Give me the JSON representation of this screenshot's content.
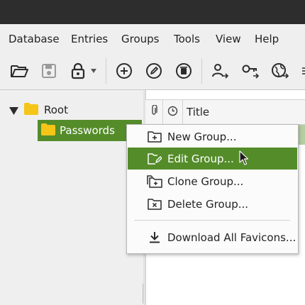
{
  "menubar": {
    "items": [
      "Database",
      "Entries",
      "Groups",
      "Tools",
      "View",
      "Help"
    ]
  },
  "toolbar": {
    "icons": [
      "open-database-icon",
      "save-database-icon",
      "lock-database-icon",
      "add-entry-icon",
      "edit-entry-icon",
      "delete-entry-icon",
      "copy-username-icon",
      "copy-password-icon",
      "open-url-icon"
    ]
  },
  "tree": {
    "root_label": "Root",
    "selected_group_label": "Passwords"
  },
  "entries_table": {
    "column_title": "Title"
  },
  "context_menu": {
    "new_group": "New Group...",
    "edit_group": "Edit Group...",
    "clone_group": "Clone Group...",
    "delete_group": "Delete Group...",
    "download_favicons": "Download All Favicons..."
  },
  "colors": {
    "accent": "#548c29",
    "titlebar": "#2d2d2d",
    "folder": "#f5c518"
  }
}
